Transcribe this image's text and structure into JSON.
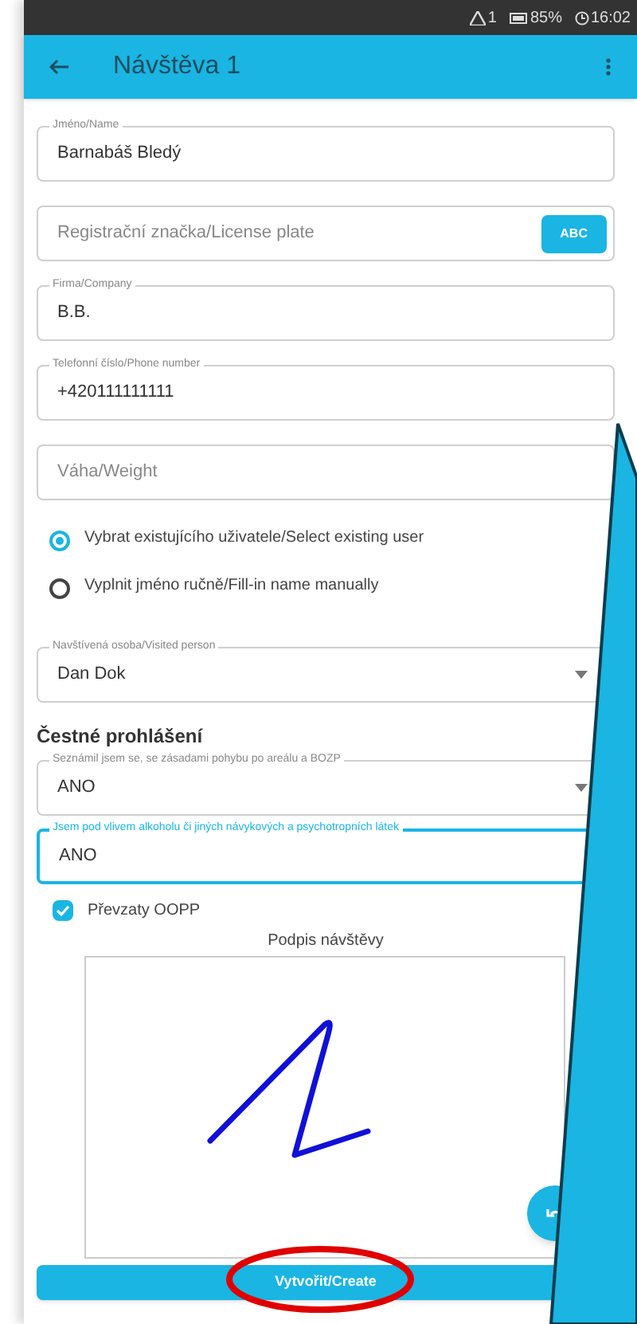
{
  "status_bar": {
    "alert_count": "1",
    "battery": "85%",
    "time": "16:02"
  },
  "app_bar": {
    "title": "Návštěva 1"
  },
  "fields": [
    {
      "kind": "text",
      "label": "Jméno/Name",
      "value": "Barnabáš Bledý"
    },
    {
      "kind": "button",
      "placeholder": "Registrační značka/License plate",
      "button": "ABC"
    },
    {
      "kind": "text",
      "label": "Firma/Company",
      "value": "B.B."
    },
    {
      "kind": "text",
      "label": "Telefonní číslo/Phone number",
      "value": "+420111111111"
    },
    {
      "kind": "text",
      "placeholder": "Váha/Weight"
    }
  ],
  "radios": [
    {
      "label": "Vybrat existujícího uživatele/Select existing user",
      "selected": true
    },
    {
      "label": "Vyplnit jméno ručně/Fill-in name manually",
      "selected": false
    }
  ],
  "visited_person": {
    "kind": "select",
    "label": "Navštívená osoba/Visited person",
    "value": "Dan Dok",
    "focused": false
  },
  "declaration": {
    "heading": "Čestné prohlášení",
    "fields": [
      {
        "kind": "select",
        "label": "Seznámil jsem se, se zásadami pohybu po areálu a BOZP",
        "value": "ANO",
        "focused": false
      },
      {
        "kind": "text",
        "label": "Jsem pod vlivem alkoholu či jiných návykových a psychotropních látek",
        "value": "ANO",
        "focused": true
      }
    ]
  },
  "checkbox": {
    "label": "Převzaty OOPP",
    "checked": true
  },
  "signature": {
    "title": "Podpis návštěvy"
  },
  "create_button": "Vytvořit/Create"
}
